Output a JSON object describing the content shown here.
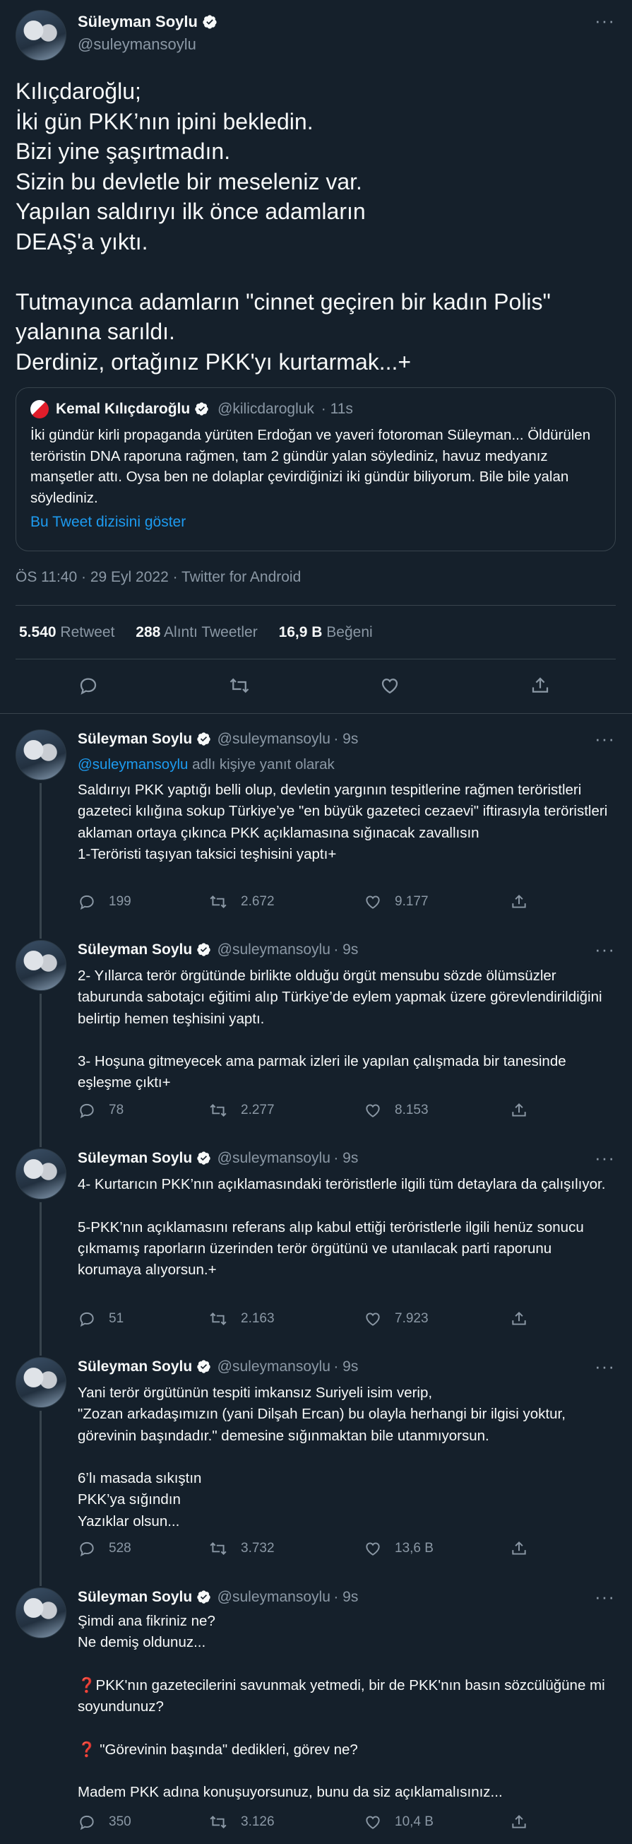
{
  "main_tweet": {
    "author_name": "Süleyman Soylu",
    "author_handle": "@suleymansoylu",
    "text": "Kılıçdaroğlu;\nİki gün PKK’nın ipini bekledin.\nBizi yine şaşırtmadın.\nSizin bu devletle bir meseleniz var.\nYapılan saldırıyı ilk önce adamların\nDEAŞ'a yıktı.\n\nTutmayınca adamların \"cinnet geçiren bir kadın Polis\" yalanına sarıldı.\nDerdiniz, ortağınız PKK'yı kurtarmak...+",
    "quote": {
      "author_name": "Kemal Kılıçdaroğlu",
      "author_handle": "@kilicdarogluk",
      "time": "· 11s",
      "text": "İki gündür kirli propaganda yürüten Erdoğan ve yaveri fotoroman Süleyman... Öldürülen teröristin DNA raporuna rağmen, tam 2 gündür yalan söylediniz, havuz medyanız manşetler attı. Oysa ben ne dolaplar çevirdiğinizi iki gündür biliyorum. Bile bile yalan söylediniz.",
      "show_thread": "Bu Tweet dizisini göster"
    },
    "meta": "ÖS 11:40 · 29 Eyl 2022 · Twitter for Android",
    "stats": {
      "retweets": "5.540",
      "retweets_label": "Retweet",
      "quotes": "288",
      "quotes_label": "Alıntı Tweetler",
      "likes": "16,9 B",
      "likes_label": "Beğeni"
    }
  },
  "replies": [
    {
      "author_name": "Süleyman Soylu",
      "author_handle": "@suleymansoylu",
      "time": "· 9s",
      "reply_to_prefix": "@suleymansoylu",
      "reply_to_suffix": " adlı kişiye yanıt olarak",
      "text": "Saldırıyı PKK yaptığı belli olup, devletin yargının tespitlerine rağmen teröristleri gazeteci kılığına sokup Türkiye’ye \"en büyük gazeteci cezaevi\" iftirasıyla teröristleri aklaman ortaya çıkınca PKK açıklamasına sığınacak zavallısın\n1-Teröristi taşıyan taksici teşhisini yaptı+",
      "replies": "199",
      "retweets": "2.672",
      "likes": "9.177"
    },
    {
      "author_name": "Süleyman Soylu",
      "author_handle": "@suleymansoylu",
      "time": "· 9s",
      "text": "2- Yıllarca terör örgütünde birlikte olduğu örgüt mensubu sözde ölümsüzler taburunda sabotajcı eğitimi alıp Türkiye’de eylem yapmak üzere görevlendirildiğini belirtip hemen teşhisini yaptı.\n\n3- Hoşuna gitmeyecek ama parmak izleri ile yapılan çalışmada bir tanesinde eşleşme çıktı+",
      "replies": "78",
      "retweets": "2.277",
      "likes": "8.153"
    },
    {
      "author_name": "Süleyman Soylu",
      "author_handle": "@suleymansoylu",
      "time": "· 9s",
      "text": "4- Kurtarıcın PKK’nın açıklamasındaki teröristlerle ilgili tüm detaylara da çalışılıyor.\n\n5-PKK’nın açıklamasını referans alıp kabul ettiği teröristlerle ilgili henüz sonucu çıkmamış raporların üzerinden terör örgütünü ve utanılacak parti raporunu korumaya alıyorsun.+",
      "replies": "51",
      "retweets": "2.163",
      "likes": "7.923"
    },
    {
      "author_name": "Süleyman Soylu",
      "author_handle": "@suleymansoylu",
      "time": "· 9s",
      "text": "Yani terör örgütünün tespiti imkansız Suriyeli isim verip,\n\"Zozan arkadaşımızın (yani Dilşah Ercan) bu olayla herhangi bir ilgisi yoktur, görevinin başındadır.\" demesine sığınmaktan bile utanmıyorsun.\n\n6’lı masada sıkıştın\nPKK’ya sığındın\nYazıklar olsun...",
      "replies": "528",
      "retweets": "3.732",
      "likes": "13,6 B"
    },
    {
      "author_name": "Süleyman Soylu",
      "author_handle": "@suleymansoylu",
      "time": "· 9s",
      "text": "Şimdi ana fikriniz ne?\nNe demiş oldunuz...\n\n❓PKK'nın gazetecilerini savunmak yetmedi, bir de PKK'nın basın sözcülüğüne mi soyundunuz?\n\n❓ \"Görevinin başında\" dedikleri, görev ne?\n\nMadem PKK adına konuşuyorsunuz, bunu da siz açıklamalısınız...",
      "replies": "350",
      "retweets": "3.126",
      "likes": "10,4 B"
    }
  ]
}
